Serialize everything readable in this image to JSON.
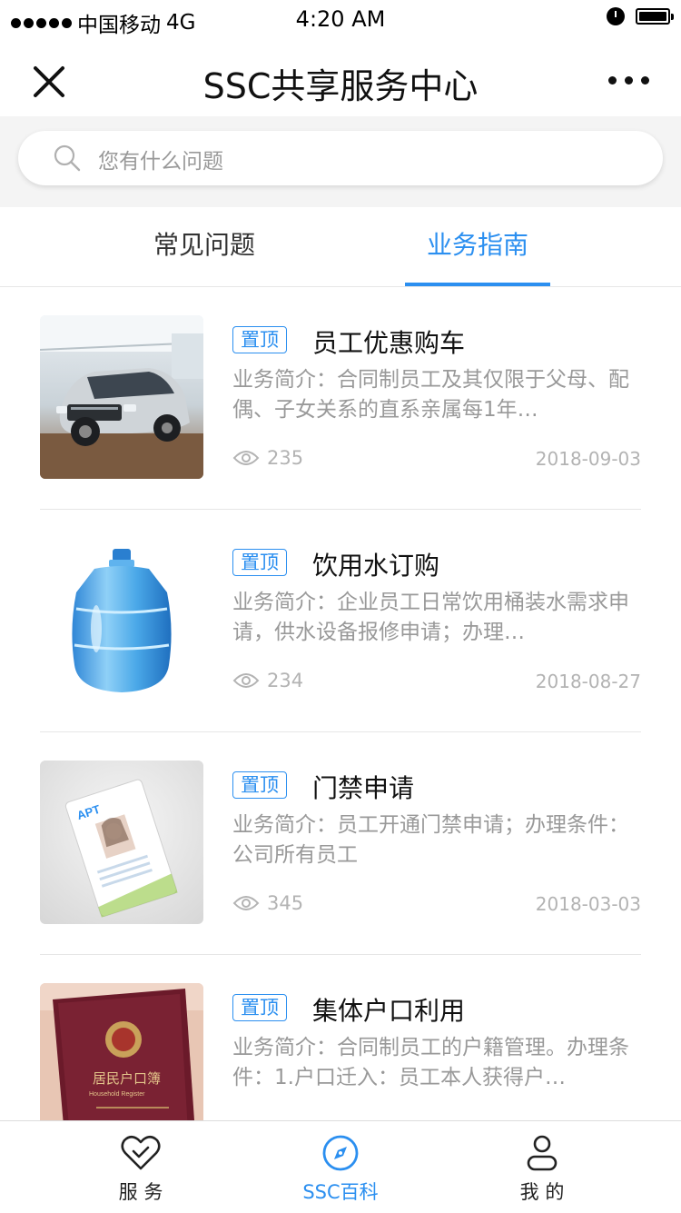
{
  "status_bar": {
    "carrier": "中国移动",
    "network": "4G",
    "time": "4:20 AM"
  },
  "nav": {
    "title": "SSC共享服务中心"
  },
  "search": {
    "placeholder": "您有什么问题"
  },
  "tabs": [
    {
      "label": "常见问题",
      "active": false
    },
    {
      "label": "业务指南",
      "active": true
    }
  ],
  "colors": {
    "accent": "#2b8ff0",
    "muted_text": "#999999"
  },
  "articles": [
    {
      "badge": "置顶",
      "title": "员工优惠购车",
      "desc": "业务简介：合同制员工及其仅限于父母、配偶、子女关系的直系亲属每1年…",
      "views": "235",
      "date": "2018-09-03",
      "thumb_icon": "car-photo"
    },
    {
      "badge": "置顶",
      "title": "饮用水订购",
      "desc": "业务简介：企业员工日常饮用桶装水需求申请，供水设备报修申请；办理…",
      "views": "234",
      "date": "2018-08-27",
      "thumb_icon": "water-bottle-photo"
    },
    {
      "badge": "置顶",
      "title": "门禁申请",
      "desc": "业务简介：员工开通门禁申请；办理条件：公司所有员工",
      "views": "345",
      "date": "2018-03-03",
      "thumb_icon": "access-card-photo"
    },
    {
      "badge": "置顶",
      "title": "集体户口利用",
      "desc": "业务简介：合同制员工的户籍管理。办理条件：1.户口迁入：员工本人获得户…",
      "views": "",
      "date": "",
      "thumb_icon": "household-register-photo"
    }
  ],
  "thumb_text": {
    "card_logo": "APT",
    "register_title": "居民户口簿",
    "register_subtitle": "Household Register"
  },
  "tab_bar": [
    {
      "label": "服 务",
      "icon": "heart-check-icon",
      "active": false
    },
    {
      "label": "SSC百科",
      "icon": "compass-icon",
      "active": true
    },
    {
      "label": "我 的",
      "icon": "user-icon",
      "active": false
    }
  ]
}
